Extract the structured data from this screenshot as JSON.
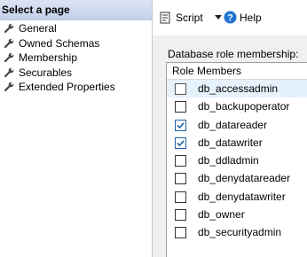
{
  "left_pane": {
    "header": "Select a page",
    "items": [
      {
        "label": "General"
      },
      {
        "label": "Owned Schemas"
      },
      {
        "label": "Membership"
      },
      {
        "label": "Securables"
      },
      {
        "label": "Extended Properties"
      }
    ]
  },
  "toolbar": {
    "script_label": "Script",
    "help_label": "Help"
  },
  "content": {
    "section_label": "Database role membership:",
    "column_header": "Role Members",
    "roles": [
      {
        "name": "db_accessadmin",
        "checked": false,
        "selected": true
      },
      {
        "name": "db_backupoperator",
        "checked": false,
        "selected": false
      },
      {
        "name": "db_datareader",
        "checked": true,
        "selected": false
      },
      {
        "name": "db_datawriter",
        "checked": true,
        "selected": false
      },
      {
        "name": "db_ddladmin",
        "checked": false,
        "selected": false
      },
      {
        "name": "db_denydatareader",
        "checked": false,
        "selected": false
      },
      {
        "name": "db_denydatawriter",
        "checked": false,
        "selected": false
      },
      {
        "name": "db_owner",
        "checked": false,
        "selected": false
      },
      {
        "name": "db_securityadmin",
        "checked": false,
        "selected": false
      }
    ]
  },
  "colors": {
    "header_bg": "#c9d6ec",
    "check_blue": "#1f5fa8",
    "help_blue": "#1e73d2",
    "selection": "#e5f1fb"
  }
}
